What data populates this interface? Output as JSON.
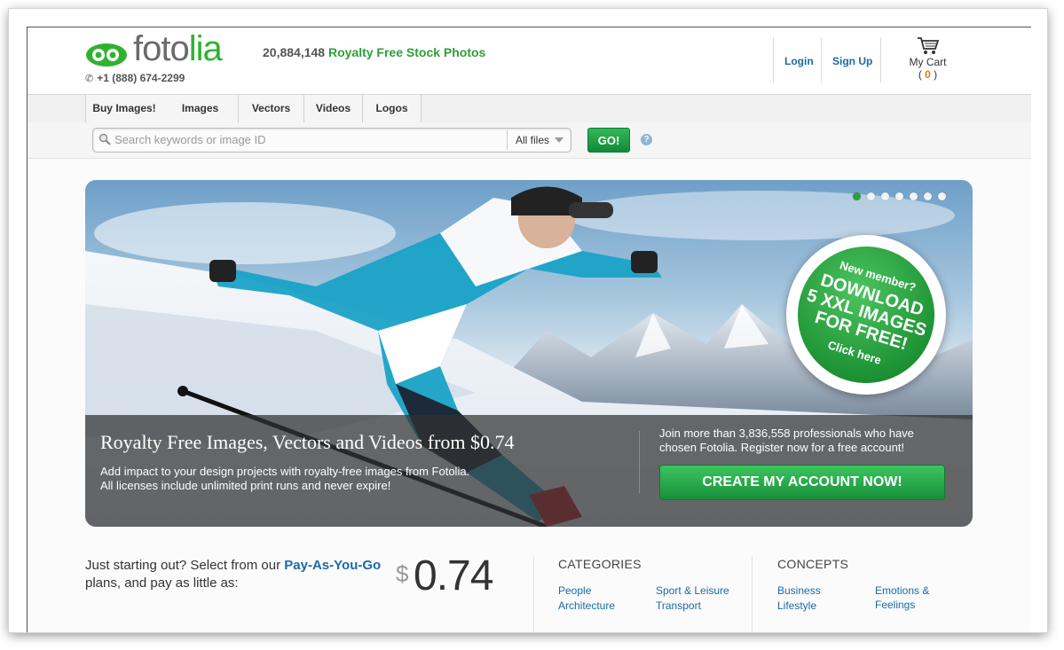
{
  "brand": {
    "logo_part1": "foto",
    "logo_part2": "lia",
    "phone": "+1 (888) 674-2299"
  },
  "tagline": {
    "count": "20,884,148",
    "text": "Royalty Free Stock Photos"
  },
  "account": {
    "login": "Login",
    "signup": "Sign Up",
    "cart_label": "My Cart",
    "cart_count": "0"
  },
  "nav": {
    "tabs": [
      "Buy Images!",
      "Images",
      "Vectors",
      "Videos",
      "Logos"
    ]
  },
  "search": {
    "placeholder": "Search keywords or image ID",
    "filter": "All files",
    "go": "GO!",
    "help": "?"
  },
  "hero": {
    "title": "Royalty Free Images, Vectors and Videos from $0.74",
    "desc_line1": "Add impact to your design projects with royalty-free images from Fotolia.",
    "desc_line2": "All licenses include unlimited print runs and never expire!",
    "join_line1": "Join more than 3,836,558 professionals who have",
    "join_line2": "chosen Fotolia. Register now for a free account!",
    "cta": "CREATE MY ACCOUNT NOW!",
    "slide_count": 7,
    "active_slide": 1,
    "badge": {
      "top": "New member?",
      "line1": "DOWNLOAD",
      "line2": "5 XXL IMAGES",
      "line3": "FOR FREE!",
      "bottom": "Click here"
    }
  },
  "pricing": {
    "intro_before": "Just starting out? Select from our ",
    "intro_link": "Pay-As-You-Go",
    "intro_after": " plans, and pay as little as:",
    "currency": "$",
    "amount": "0.74"
  },
  "categories": {
    "title": "CATEGORIES",
    "items": [
      "People",
      "Sport & Leisure",
      "Architecture",
      "Transport"
    ]
  },
  "concepts": {
    "title": "CONCEPTS",
    "items": [
      "Business",
      "Emotions &",
      "Feelings",
      "Lifestyle"
    ]
  },
  "colors": {
    "brand_green": "#2fb32f",
    "link_blue": "#1e6aa0",
    "cart_count": "#e07f00"
  }
}
